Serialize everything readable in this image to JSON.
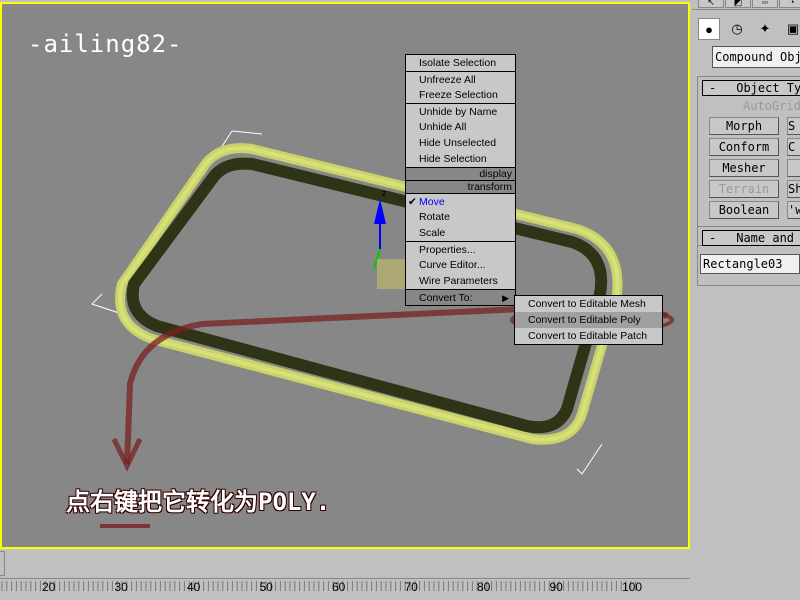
{
  "viewport": {
    "watermark": "-ailing82-",
    "caption": "点右键把它转化为POLY.",
    "accent_border": "#ffff00",
    "background": "#878787",
    "gizmo_axis_label": "z"
  },
  "quad_menu": {
    "display_items": [
      "Isolate Selection",
      "Unfreeze All",
      "Freeze Selection",
      "Unhide by Name",
      "Unhide All",
      "Hide Unselected",
      "Hide Selection"
    ],
    "display_header": "display",
    "transform_header": "transform",
    "transform_items": [
      "Move",
      "Rotate",
      "Scale",
      "Properties...",
      "Curve Editor...",
      "Wire Parameters",
      "Convert To:"
    ],
    "checked_item": "Move",
    "submenu": [
      "Convert to Editable Mesh",
      "Convert to Editable Poly",
      "Convert to Editable Patch"
    ]
  },
  "command_panel": {
    "category_dropdown": "Compound Objects",
    "object_type_rollout": {
      "collapse": "-",
      "title": "Object Type",
      "autogrid": "AutoGrid",
      "buttons_left": [
        "Morph",
        "Conform",
        "Mesher",
        "Terrain",
        "Boolean"
      ],
      "buttons_right": [
        "S",
        "C",
        "",
        "Sh",
        "'wr"
      ]
    },
    "name_rollout": {
      "collapse": "-",
      "title": "Name and Color",
      "name_value": "Rectangle03"
    }
  },
  "timeline": {
    "tick_labels": [
      "20",
      "30",
      "40",
      "50",
      "60",
      "70",
      "80",
      "90",
      "100"
    ]
  }
}
